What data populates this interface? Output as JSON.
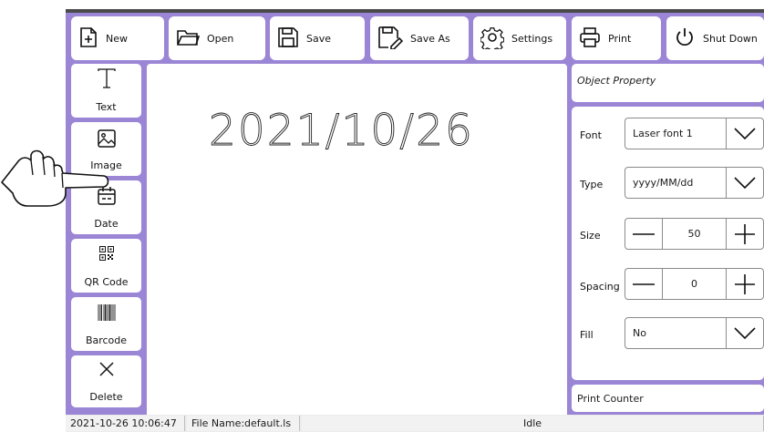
{
  "toolbar": {
    "new_label": "New",
    "open_label": "Open",
    "save_label": "Save",
    "save_as_label": "Save As",
    "settings_label": "Settings",
    "print_label": "Print",
    "shutdown_label": "Shut Down"
  },
  "tools": {
    "text_label": "Text",
    "image_label": "Image",
    "date_label": "Date",
    "qr_label": "QR Code",
    "barcode_label": "Barcode",
    "delete_label": "Delete"
  },
  "canvas": {
    "text": "2021/10/26"
  },
  "properties": {
    "title": "Object Property",
    "font_label": "Font",
    "font_value": "Laser font 1",
    "type_label": "Type",
    "type_value": "yyyy/MM/dd",
    "size_label": "Size",
    "size_value": "50",
    "spacing_label": "Spacing",
    "spacing_value": "0",
    "fill_label": "Fill",
    "fill_value": "No",
    "counter_label": "Print Counter"
  },
  "status": {
    "datetime": "2021-10-26 10:06:47",
    "file_name": "File Name:default.ls",
    "state": "Idle"
  },
  "colors": {
    "accent": "#9b86d6"
  }
}
